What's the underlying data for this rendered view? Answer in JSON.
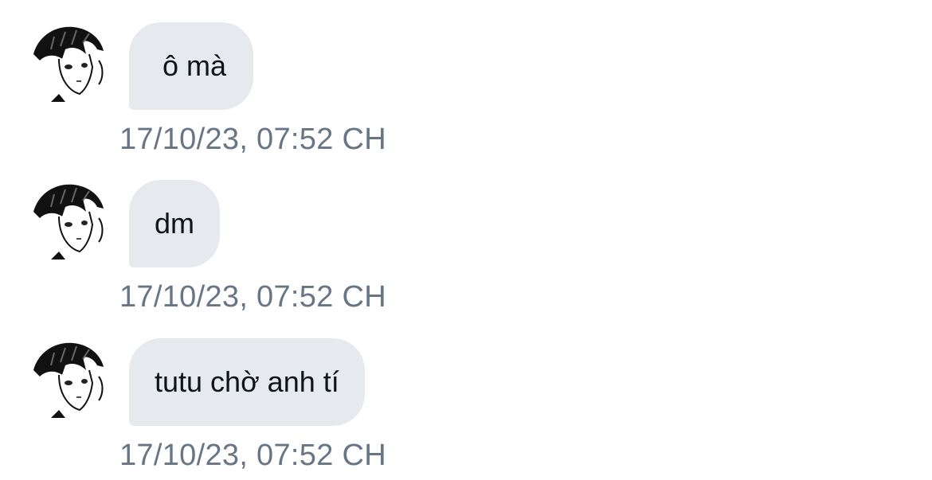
{
  "messages": [
    {
      "text": "ô mà",
      "timestamp": "17/10/23, 07:52 CH",
      "avatar_icon": "manga-character-avatar"
    },
    {
      "text": "dm",
      "timestamp": "17/10/23, 07:52 CH",
      "avatar_icon": "manga-character-avatar"
    },
    {
      "text": "tutu chờ anh tí",
      "timestamp": "17/10/23, 07:52 CH",
      "avatar_icon": "manga-character-avatar"
    }
  ],
  "colors": {
    "bubble_background": "#e6eaee",
    "message_text": "#0f1419",
    "timestamp_text": "#677585",
    "page_background": "#ffffff"
  }
}
